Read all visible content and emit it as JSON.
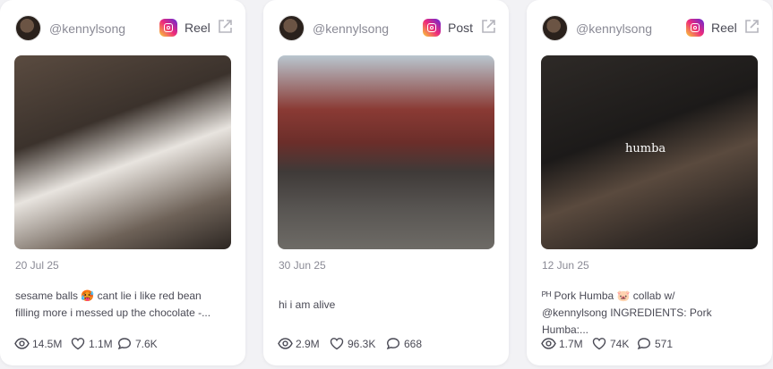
{
  "cards": [
    {
      "handle": "@kennylsong",
      "post_type": "Reel",
      "platform_icon": "instagram-icon",
      "date": "20 Jul 25",
      "caption_line1": "sesame balls 🥵 cant lie i like red bean",
      "caption_line2": "filling more i messed up the chocolate -...",
      "views": "14.5M",
      "likes": "1.1M",
      "comments": "7.6K"
    },
    {
      "handle": "@kennylsong",
      "post_type": "Post",
      "platform_icon": "instagram-icon",
      "date": "30 Jun 25",
      "caption_line1": "hi i am alive",
      "views": "2.9M",
      "likes": "96.3K",
      "comments": "668"
    },
    {
      "handle": "@kennylsong",
      "post_type": "Reel",
      "platform_icon": "instagram-icon",
      "date": "12 Jun 25",
      "media_overlay_text": "humba",
      "caption_line1": "ᴾᴴ Pork Humba 🐷 collab w/",
      "caption_line2": "@kennylsong INGREDIENTS: Pork Humba:...",
      "views": "1.7M",
      "likes": "74K",
      "comments": "571"
    }
  ],
  "colors": {
    "instagram_gradient": [
      "#f9ce34",
      "#ee2a7b",
      "#6228d7"
    ],
    "text_muted": "#8a8a95",
    "text": "#4a4a55"
  }
}
